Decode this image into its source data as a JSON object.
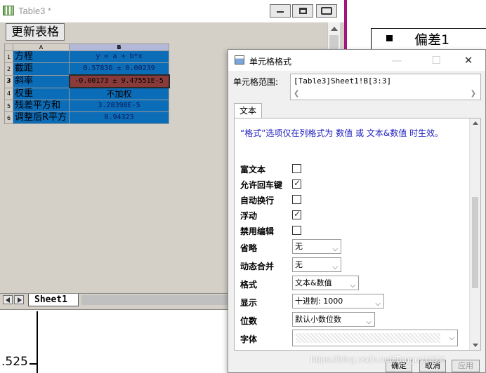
{
  "graph": {
    "tick_label": ".525",
    "legend_label": "偏差1"
  },
  "worksheet": {
    "title": "Table3 *",
    "update_button": "更新表格",
    "columns": [
      "A",
      "B"
    ],
    "rows": [
      {
        "num": "1",
        "a": "方程",
        "b": "y = a + b*x"
      },
      {
        "num": "2",
        "a": "截距",
        "b": "0.57836 ± 0.00239"
      },
      {
        "num": "3",
        "a": "斜率",
        "b": "-0.00173 ± 9.47551E-5"
      },
      {
        "num": "4",
        "a": "权重",
        "b": "不加权"
      },
      {
        "num": "5",
        "a": "残差平方和",
        "b": "3.28398E-5"
      },
      {
        "num": "6",
        "a": "调整后R平方",
        "b": "0.94323"
      }
    ],
    "sheet_tab": "Sheet1"
  },
  "dialog": {
    "title": "单元格格式",
    "range_label": "单元格范围:",
    "range_value": "[Table3]Sheet1!B[3:3]",
    "tab_label": "文本",
    "notice": "“格式”选项仅在列格式为 数值 或 文本&数值 时生效。",
    "checks": [
      {
        "label": "富文本",
        "checked": false
      },
      {
        "label": "允许回车键",
        "checked": true
      },
      {
        "label": "自动换行",
        "checked": false
      },
      {
        "label": "浮动",
        "checked": true
      },
      {
        "label": "禁用编辑",
        "checked": false
      }
    ],
    "omit_label": "省略",
    "omit_value": "无",
    "merge_label": "动态合并",
    "merge_value": "无",
    "format_label": "格式",
    "format_value": "文本&数值",
    "display_label": "显示",
    "display_value": "十进制: 1000",
    "digits_label": "位数",
    "digits_value": "默认小数位数",
    "font_label": "字体",
    "ok": "确定",
    "cancel": "取消",
    "apply": "应用"
  },
  "watermark": "https://blog.csdn.net/Tanguy1024",
  "colors": {
    "cell_blue": "#0b6cb8",
    "active_cell": "#8b3a3a",
    "accent_magenta": "#a3157e",
    "notice_text": "#2020c0"
  }
}
